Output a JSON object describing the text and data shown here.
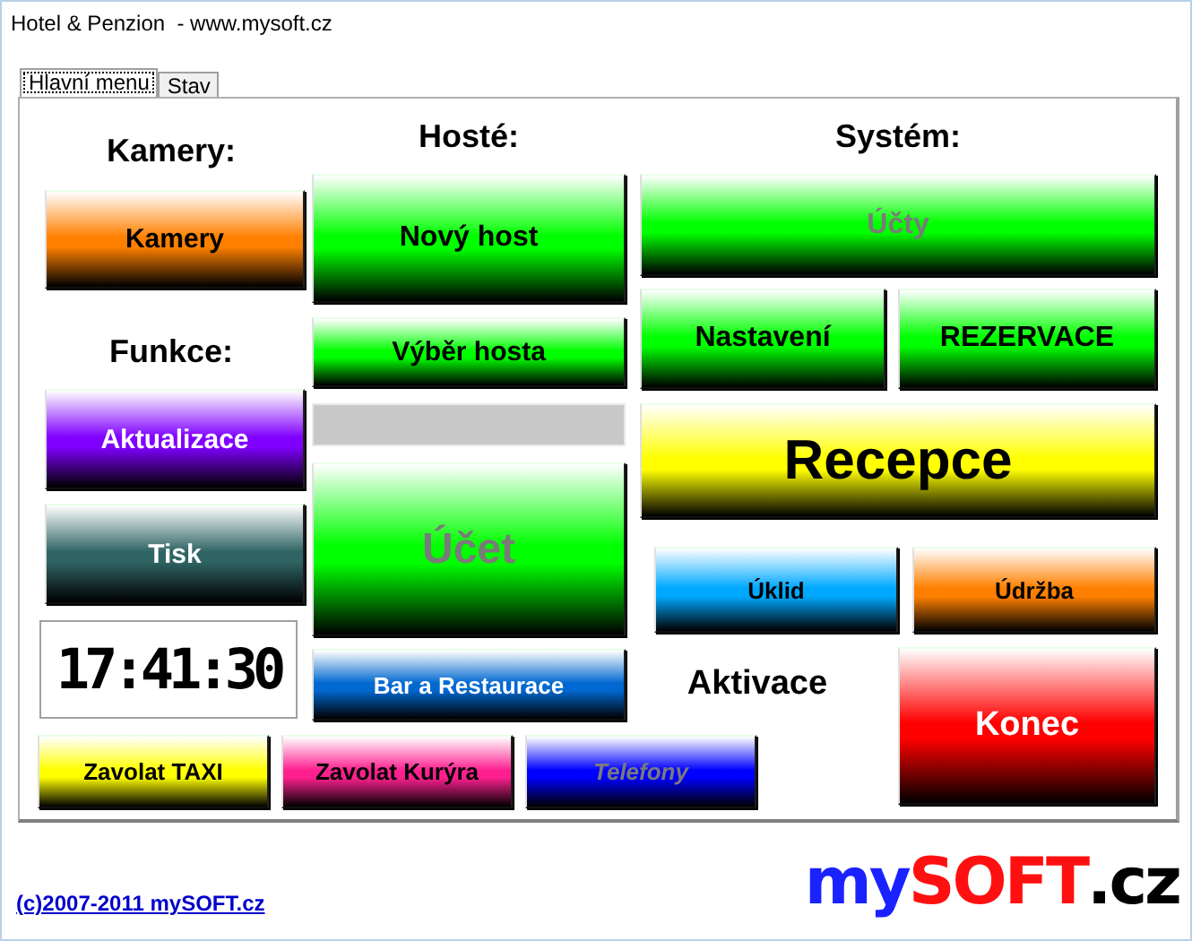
{
  "window": {
    "title": "Hotel & Penzion  - www.mysoft.cz"
  },
  "tabs": [
    {
      "label": "Hlavní menu",
      "selected": true
    },
    {
      "label": "Stav",
      "selected": false
    }
  ],
  "cameras": {
    "heading": "Kamery:",
    "buttons": [
      {
        "label": "Kamery",
        "color": "#ff8000",
        "disabled": false
      }
    ]
  },
  "functions": {
    "heading": "Funkce:",
    "buttons": [
      {
        "label": "Aktualizace",
        "color": "#8000ff",
        "disabled": false
      },
      {
        "label": "Tisk",
        "color": "#2f6464",
        "disabled": false
      }
    ]
  },
  "clock": {
    "time": "17:41:30"
  },
  "guests": {
    "heading": "Hosté:",
    "buttons": [
      {
        "label": "Nový host",
        "color": "#00ff00",
        "disabled": false
      },
      {
        "label": "Výběr hosta",
        "color": "#00ff00",
        "disabled": false
      },
      {
        "label": "Účet",
        "color": "#00ff00",
        "disabled": true
      },
      {
        "label": "Bar a Restaurace",
        "color": "#0068d0",
        "disabled": false
      }
    ]
  },
  "system": {
    "heading": "Systém:",
    "activation_label": "Aktivace",
    "buttons": [
      {
        "label": "Účty",
        "color": "#00ff00",
        "disabled": true
      },
      {
        "label": "Nastavení",
        "color": "#00ff00",
        "disabled": false
      },
      {
        "label": "REZERVACE",
        "color": "#00ff00",
        "disabled": false
      },
      {
        "label": "Recepce",
        "color": "#ffff00",
        "disabled": false
      },
      {
        "label": "Úklid",
        "color": "#00a8ff",
        "disabled": false
      },
      {
        "label": "Údržba",
        "color": "#ff8000",
        "disabled": false
      },
      {
        "label": "Konec",
        "color": "#ff0000",
        "disabled": false
      }
    ]
  },
  "quick_buttons": [
    {
      "label": "Zavolat TAXI",
      "color": "#ffff00",
      "disabled": false
    },
    {
      "label": "Zavolat Kurýra",
      "color": "#ff2090",
      "disabled": false
    },
    {
      "label": "Telefony",
      "color": "#0000ff",
      "disabled": true
    }
  ],
  "footer": {
    "copyright_link": "(c)2007-2011 mySOFT.cz",
    "logo": [
      {
        "text": "my",
        "color": "#1a22ff"
      },
      {
        "text": "SOFT",
        "color": "#ff1010"
      },
      {
        "text": ".cz",
        "color": "#000000"
      }
    ]
  }
}
